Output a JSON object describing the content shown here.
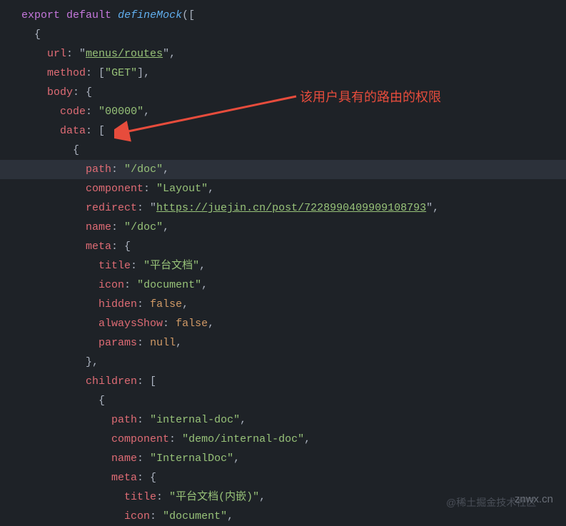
{
  "annotation": "该用户具有的路由的权限",
  "watermark_right": "znwx.cn",
  "watermark_mid": "@稀土掘金技术社区",
  "code": {
    "export": "export",
    "default": "default",
    "defineMock": "defineMock",
    "url_key": "url",
    "url_val": "menus/routes",
    "method_key": "method",
    "method_val": "GET",
    "body_key": "body",
    "code_key": "code",
    "code_val": "00000",
    "data_key": "data",
    "path_key": "path",
    "path_val": "/doc",
    "component_key": "component",
    "component_val": "Layout",
    "redirect_key": "redirect",
    "redirect_val": "https://juejin.cn/post/7228990409909108793",
    "name_key": "name",
    "name_val": "/doc",
    "meta_key": "meta",
    "title_key": "title",
    "title_val": "平台文档",
    "icon_key": "icon",
    "icon_val": "document",
    "hidden_key": "hidden",
    "false_val": "false",
    "alwaysShow_key": "alwaysShow",
    "params_key": "params",
    "null_val": "null",
    "children_key": "children",
    "child_path_val": "internal-doc",
    "child_component_val": "demo/internal-doc",
    "child_name_val": "InternalDoc",
    "child_title_val": "平台文档(内嵌)",
    "child_icon_val": "document"
  }
}
